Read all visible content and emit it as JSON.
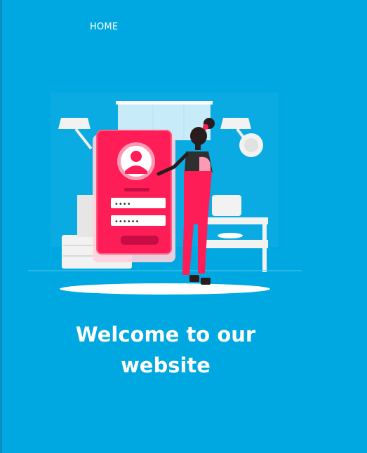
{
  "nav": {
    "home_label": "HOME"
  },
  "hero": {
    "title_line1": "Welcome to our",
    "title_line2": "website"
  },
  "illustration": {
    "password_dots_short": "••••",
    "password_dots_long": "••••••",
    "colors": {
      "background": "#00a8e1",
      "accent": "#ff1d58",
      "accent_dark": "#c80d44",
      "furniture": "#f2f2f2",
      "skin": "#3a2a2a"
    }
  }
}
